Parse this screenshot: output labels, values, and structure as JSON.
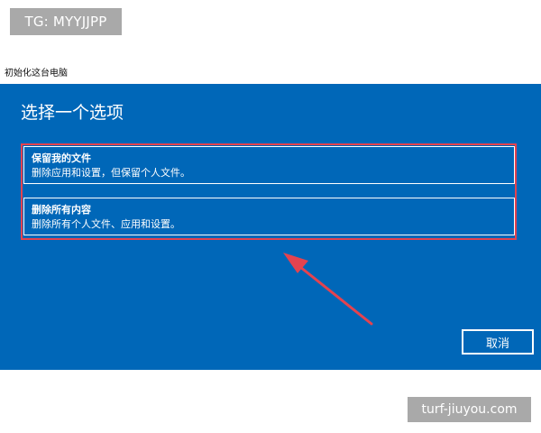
{
  "watermark_top": "TG: MYYJJPP",
  "window_title": "初始化这台电脑",
  "dialog": {
    "heading": "选择一个选项",
    "options": [
      {
        "title": "保留我的文件",
        "description": "删除应用和设置，但保留个人文件。"
      },
      {
        "title": "删除所有内容",
        "description": "删除所有个人文件、应用和设置。"
      }
    ],
    "cancel_label": "取消"
  },
  "watermark_bottom": "turf-jiuyou.com",
  "colors": {
    "panel_bg": "#0067b8",
    "highlight": "#e4434f",
    "arrow": "#e4434f",
    "watermark_bg": "#a9a9a9"
  }
}
